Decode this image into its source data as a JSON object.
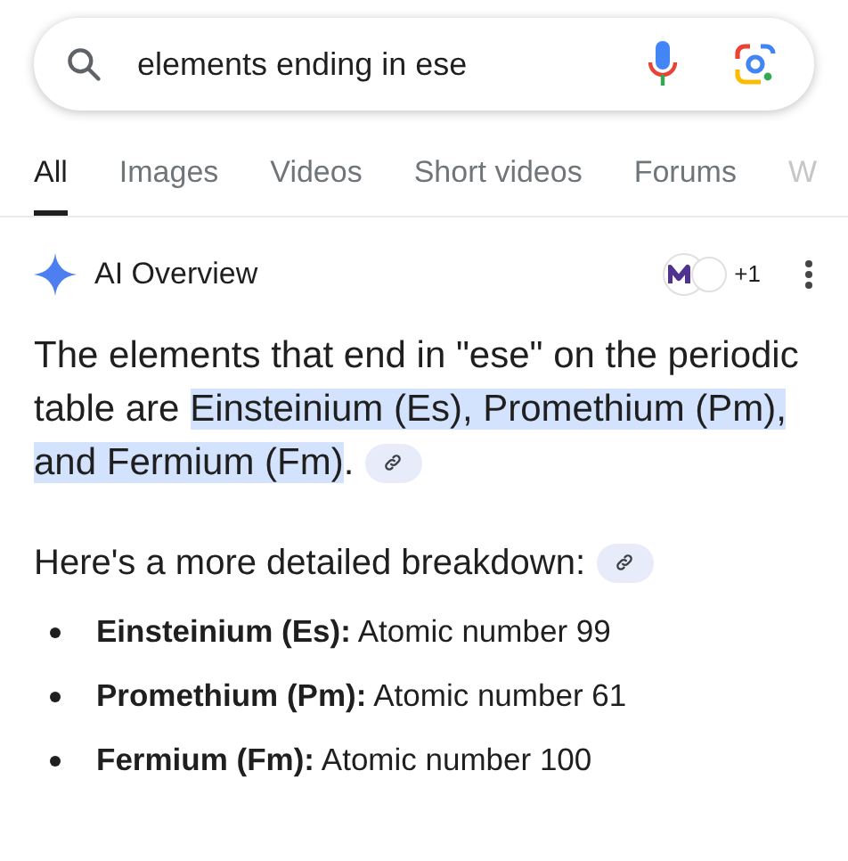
{
  "search": {
    "value": "elements ending in ese"
  },
  "tabs": [
    {
      "label": "All",
      "selected": true
    },
    {
      "label": "Images",
      "selected": false
    },
    {
      "label": "Videos",
      "selected": false
    },
    {
      "label": "Short videos",
      "selected": false
    },
    {
      "label": "Forums",
      "selected": false
    },
    {
      "label": "W",
      "selected": false
    }
  ],
  "overview": {
    "title": "AI Overview",
    "sources_count": "+1",
    "summary": [
      {
        "text": "The elements that end in \"ese\" on the periodic table are ",
        "highlighted": false
      },
      {
        "text": "Einsteinium (Es), Promethium (Pm), and Fermium (Fm)",
        "highlighted": true
      },
      {
        "text": ".",
        "highlighted": false
      }
    ],
    "breakdown_heading": "Here's a more detailed breakdown:",
    "items": [
      {
        "term": "Einsteinium (Es):",
        "detail": "Atomic number 99"
      },
      {
        "term": "Promethium (Pm):",
        "detail": "Atomic number 61"
      },
      {
        "term": "Fermium (Fm):",
        "detail": "Atomic number 100"
      }
    ]
  }
}
